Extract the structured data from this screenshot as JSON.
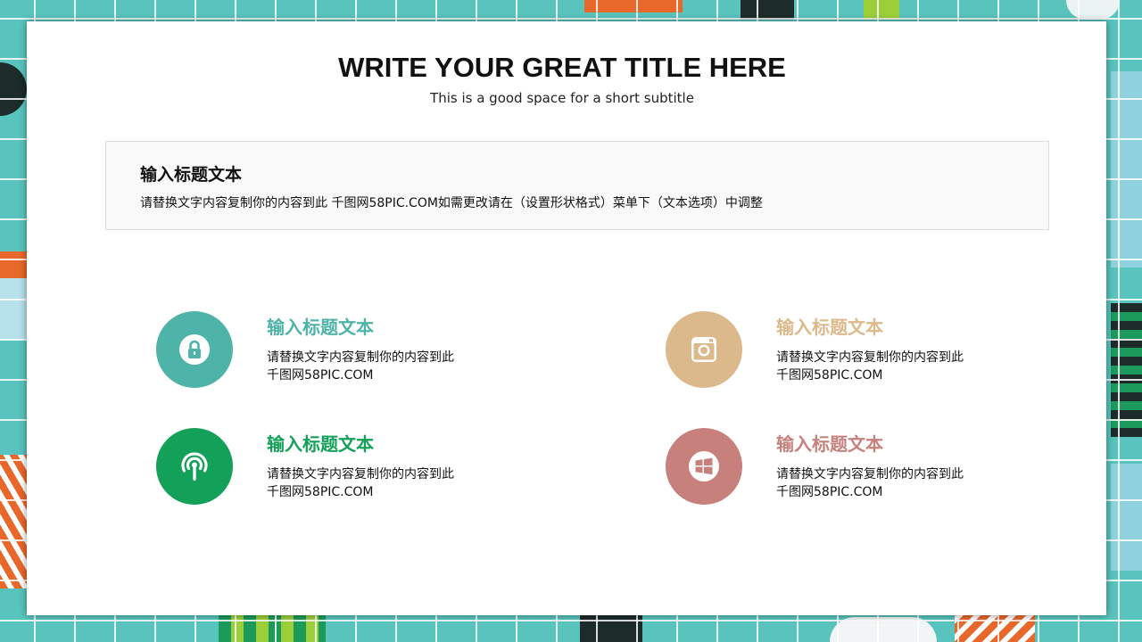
{
  "title": "WRITE YOUR GREAT TITLE HERE",
  "subtitle": "This is a good space for a short subtitle",
  "intro": {
    "heading": "输入标题文本",
    "text": "请替换文字内容复制你的内容到此 千图网58PIC.COM如需更改请在（设置形状格式）菜单下（文本选项）中调整"
  },
  "features": [
    {
      "icon": "lock-icon",
      "color": "#4eb3a8",
      "heading": "输入标题文本",
      "line1": "请替换文字内容复制你的内容到此",
      "line2": "千图网58PIC.COM"
    },
    {
      "icon": "instagram-icon",
      "color": "#dcb98b",
      "heading": "输入标题文本",
      "line1": "请替换文字内容复制你的内容到此",
      "line2": "千图网58PIC.COM"
    },
    {
      "icon": "broadcast-icon",
      "color": "#13a058",
      "heading": "输入标题文本",
      "line1": "请替换文字内容复制你的内容到此",
      "line2": "千图网58PIC.COM"
    },
    {
      "icon": "windows-icon",
      "color": "#c7807c",
      "heading": "输入标题文本",
      "line1": "请替换文字内容复制你的内容到此",
      "line2": "千图网58PIC.COM"
    }
  ],
  "colors": {
    "background": "#58c4bd",
    "card": "#ffffff",
    "intro_box": "#f9f9f9"
  }
}
